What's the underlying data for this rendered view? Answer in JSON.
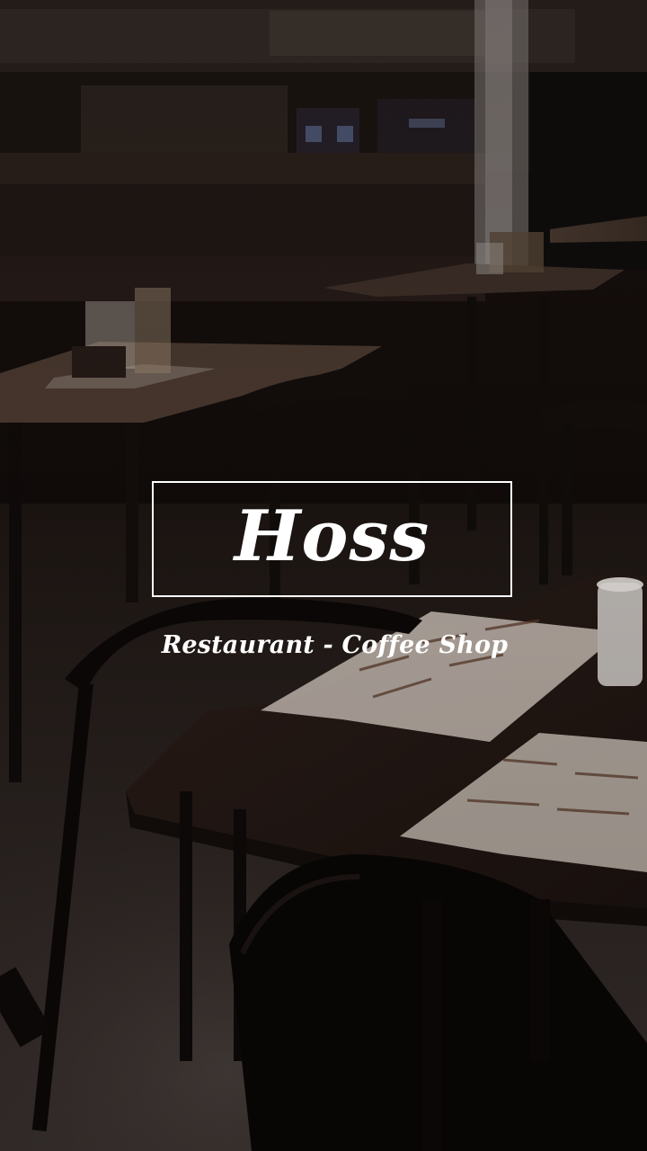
{
  "splash": {
    "brand_name": "Hoss",
    "tagline": "Restaurant - Coffee Shop"
  },
  "colors": {
    "text": "#ffffff",
    "background": "#0d0908"
  }
}
